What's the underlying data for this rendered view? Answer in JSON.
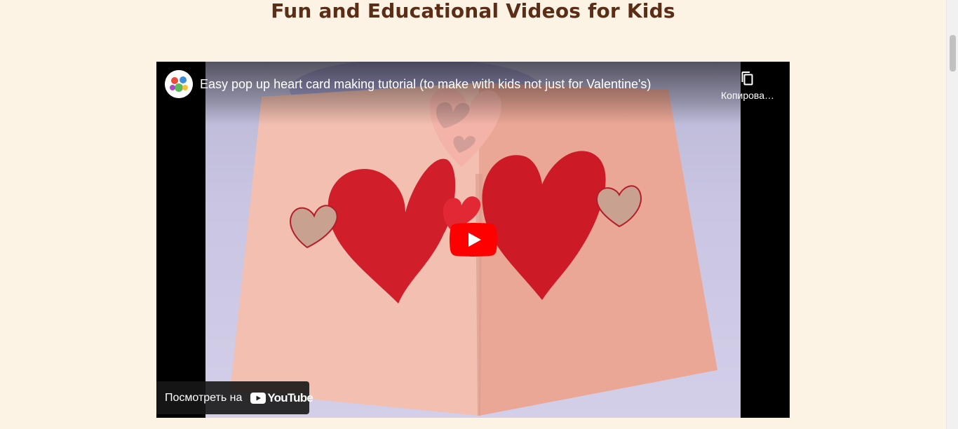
{
  "section": {
    "title": "Fun and Educational Videos for Kids"
  },
  "video": {
    "title": "Easy pop up heart card making tutorial (to make with kids not just for Valentine's)",
    "copy_label": "Копирова…",
    "watch_on_label": "Посмотреть на",
    "youtube_wordmark": "YouTube",
    "icons": {
      "avatar": "channel-avatar",
      "copy": "copy-link-icon",
      "play": "play-icon",
      "logo": "youtube-logo-icon"
    }
  },
  "colors": {
    "page_background": "#fdf3e5",
    "title": "#5a2d17",
    "youtube_red": "#ff0000",
    "heart_red": "#d6202b",
    "card_pink": "#f2b9a8"
  }
}
